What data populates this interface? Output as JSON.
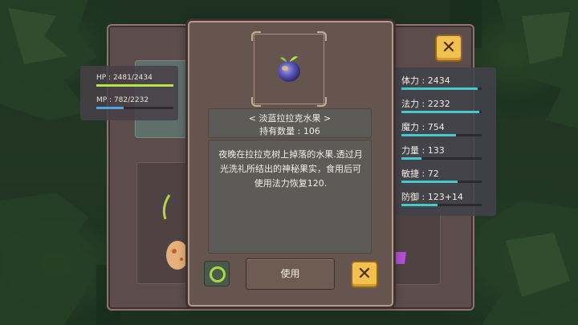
{
  "player": {
    "hp": "HP : 2481/2434",
    "hp_fraction": 1.0,
    "mp": "MP : 782/2232",
    "mp_fraction": 0.35
  },
  "stats": [
    {
      "label": "体力 : 2434",
      "fraction": 0.95
    },
    {
      "label": "法力 : 2232",
      "fraction": 0.97
    },
    {
      "label": "魔力 : 754",
      "fraction": 0.68
    },
    {
      "label": "力量 : 133",
      "fraction": 0.25
    },
    {
      "label": "敏捷 : 72",
      "fraction": 0.7
    },
    {
      "label": "防御 : 123+14",
      "fraction": 0.45
    }
  ],
  "item": {
    "name": "< 淡蓝拉拉克水果 >",
    "quantity": "持有数量 : 106",
    "description": "夜晚在拉拉克树上掉落的水果.透过月光洗礼所结出的神秘果实，食用后可使用法力恢复120.",
    "icon": "blue-lalak-fruit-icon"
  },
  "buttons": {
    "use_label": "使用",
    "close_glyph": "✕",
    "cancel_glyph": "✕"
  },
  "colors": {
    "hp_bar": "#b8e24a",
    "mp_bar": "#4fa4e8",
    "stat_bar": "#46c9c9",
    "close_button": "#f1c04e",
    "confirm_ring": "#a5d84a"
  }
}
